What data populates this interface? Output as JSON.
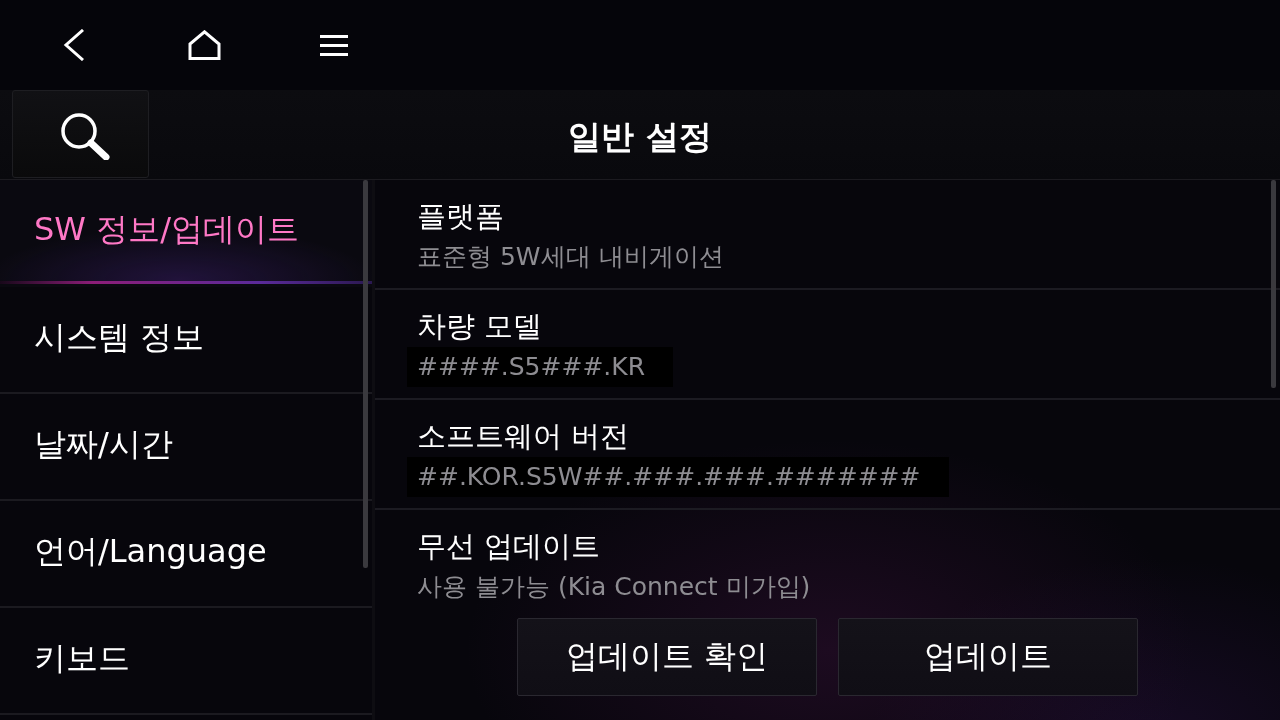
{
  "header": {
    "title": "일반 설정"
  },
  "sidebar": {
    "items": [
      {
        "label": "SW 정보/업데이트",
        "selected": true
      },
      {
        "label": "시스템 정보",
        "selected": false
      },
      {
        "label": "날짜/시간",
        "selected": false
      },
      {
        "label": "언어/Language",
        "selected": false
      },
      {
        "label": "키보드",
        "selected": false
      }
    ]
  },
  "details": {
    "rows": [
      {
        "title": "플랫폼",
        "value": "표준형 5W세대 내비게이션",
        "boxed": false
      },
      {
        "title": "차량 모델",
        "value": "####.S5###.KR",
        "boxed": true
      },
      {
        "title": "소프트웨어 버전",
        "value": "##.KOR.S5W##.###.###.#######",
        "boxed": true
      },
      {
        "title": "무선 업데이트",
        "value": "사용 불가능 (Kia Connect 미가입)",
        "boxed": false
      }
    ],
    "buttons": [
      "업데이트 확인",
      "업데이트"
    ]
  }
}
